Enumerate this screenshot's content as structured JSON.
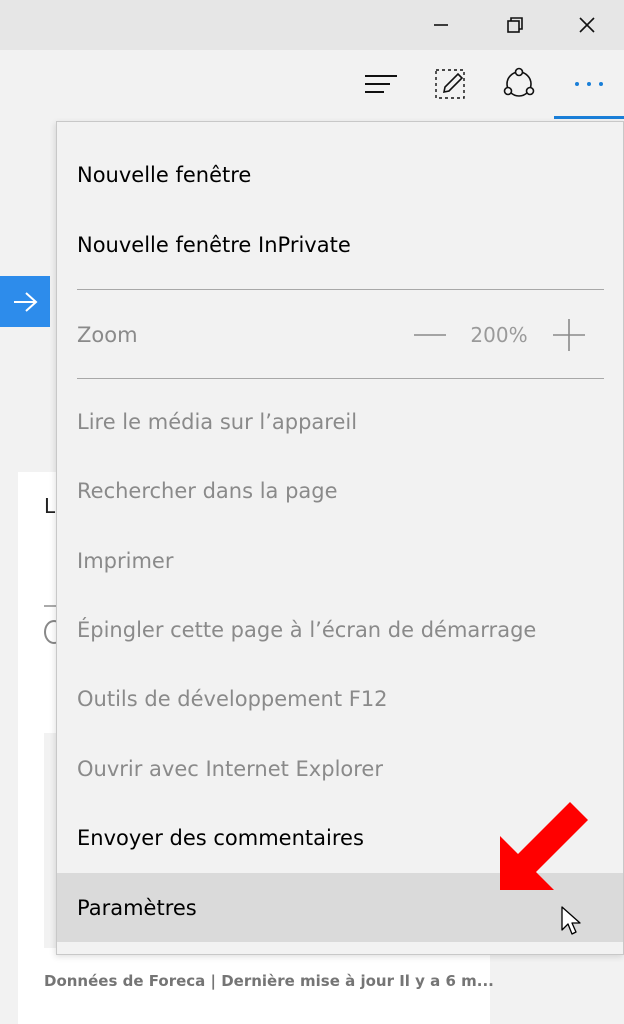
{
  "window_controls": {
    "minimize_icon": "minimize-icon",
    "restore_icon": "restore-icon",
    "close_icon": "close-icon"
  },
  "toolbar": {
    "icons": [
      "hub-icon",
      "web-note-icon",
      "share-icon",
      "more-icon"
    ],
    "accent_color": "#1a7fd8"
  },
  "menu": {
    "items_top": [
      {
        "label": "Nouvelle fenêtre",
        "enabled": true
      },
      {
        "label": "Nouvelle fenêtre InPrivate",
        "enabled": true
      }
    ],
    "zoom": {
      "label": "Zoom",
      "value": "200%"
    },
    "items_bottom": [
      {
        "label": "Lire le média sur l’appareil",
        "enabled": false
      },
      {
        "label": "Rechercher dans la page",
        "enabled": false
      },
      {
        "label": "Imprimer",
        "enabled": false
      },
      {
        "label": "Épingler cette page à l’écran de démarrage",
        "enabled": false
      },
      {
        "label": "Outils de développement F12",
        "enabled": false
      },
      {
        "label": "Ouvrir avec Internet Explorer",
        "enabled": false
      },
      {
        "label": "Envoyer des commentaires",
        "enabled": true
      },
      {
        "label": "Paramètres",
        "enabled": true,
        "hovered": true
      }
    ]
  },
  "background": {
    "card_initial": "L",
    "footer_text": "Données de Foreca | Dernière mise à jour Il y a 6 m...",
    "go_button_color": "#2d8ceb"
  },
  "annotation": {
    "arrow_color": "#ff0000"
  }
}
